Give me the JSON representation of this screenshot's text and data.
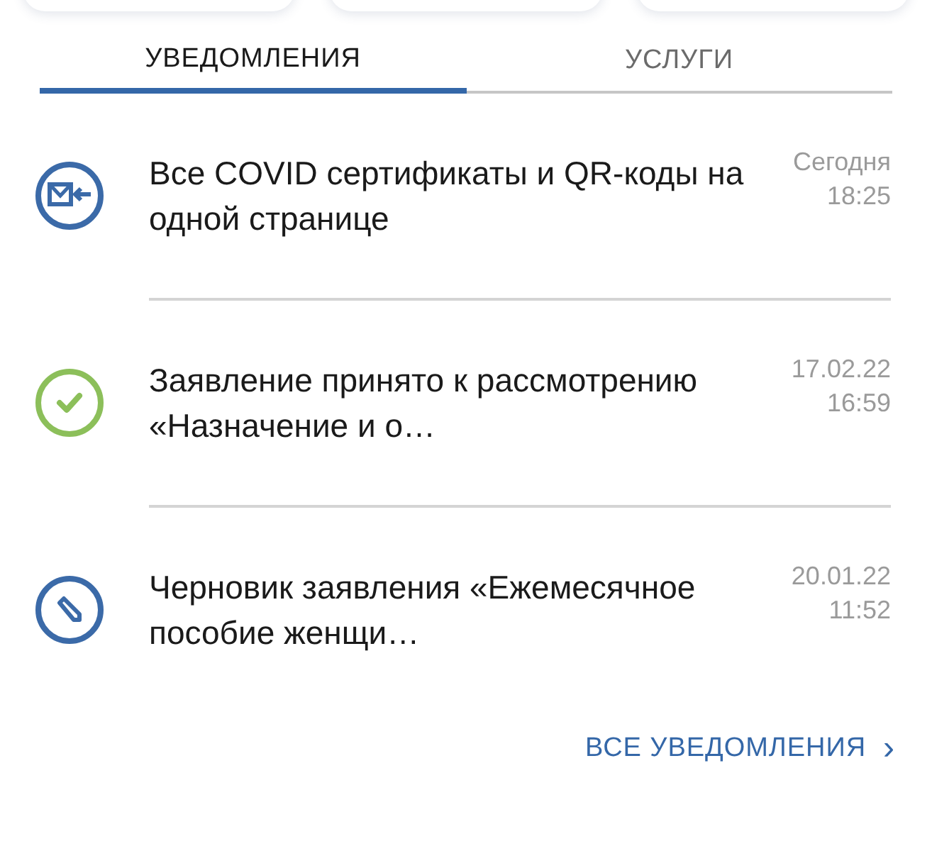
{
  "top_cards": [
    {
      "kind": "card"
    },
    {
      "kind": "card"
    },
    {
      "kind": "card"
    }
  ],
  "tabs": [
    {
      "label": "УВЕДОМЛЕНИЯ",
      "selected": true
    },
    {
      "label": "УСЛУГИ",
      "selected": false
    }
  ],
  "notifications": [
    {
      "kind": "message",
      "text": "Все COVID сертификаты и QR-коды на одной странице",
      "date": "Сегодня",
      "time": "18:25"
    },
    {
      "kind": "accepted",
      "text": "Заявление принято к рассмотрению «Назначение и о…",
      "date": "17.02.22",
      "time": "16:59"
    },
    {
      "kind": "draft",
      "text": "Черновик заявления «Ежемесячное пособие женщи…",
      "date": "20.01.22",
      "time": "11:52"
    }
  ],
  "all_link": {
    "label": "ВСЕ УВЕДОМЛЕНИЯ",
    "chevron": "›"
  }
}
